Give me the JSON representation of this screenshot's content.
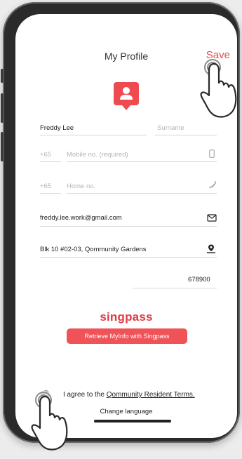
{
  "header": {
    "title": "My Profile",
    "save_label": "Save"
  },
  "form": {
    "first_name_value": "Freddy Lee",
    "surname_placeholder": "Surname",
    "mobile_prefix": "+65",
    "mobile_placeholder": "Mobile no. (required)",
    "home_prefix": "+65",
    "home_placeholder": "Home no.",
    "email_value": "freddy.lee.work@gmail.com",
    "address_value": "Blk 10 #02-03, Qommunity Gardens",
    "postal_value": "678900"
  },
  "singpass": {
    "brand": "singpass",
    "button_label": "Retrieve MyInfo with Singpass"
  },
  "footer": {
    "agree_prefix": "I agree to the",
    "terms_link": "Qommunity Resident Terms.",
    "change_language": "Change language"
  },
  "colors": {
    "accent": "#e8484c",
    "button": "#ef5257"
  },
  "icons": [
    "profile-icon",
    "phone-icon",
    "home-phone-icon",
    "mail-icon",
    "location-icon",
    "check-icon",
    "tap-hand-icon"
  ]
}
